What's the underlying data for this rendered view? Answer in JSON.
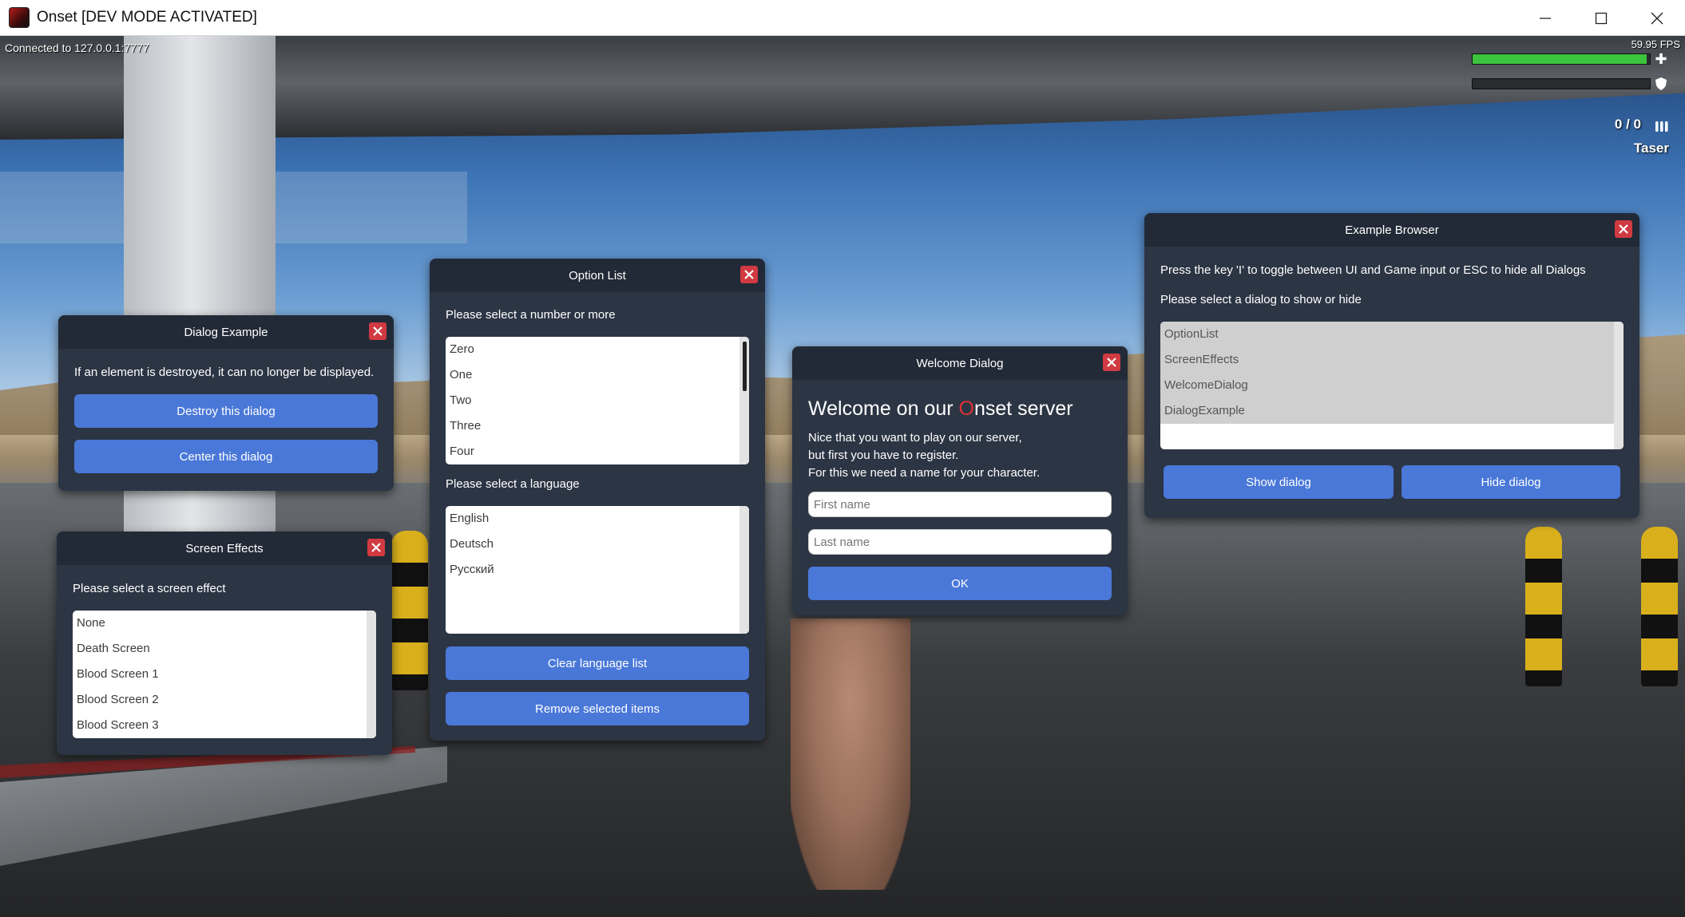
{
  "window": {
    "title": "Onset [DEV MODE ACTIVATED]"
  },
  "hud": {
    "connected": "Connected to 127.0.0.1:7777",
    "fps": "59.95 FPS",
    "health_fraction": 0.98,
    "armor_fraction": 0.0,
    "ammo": "0 / 0",
    "weapon": "Taser",
    "health_icon": "plus-icon",
    "armor_icon": "shield-icon",
    "ammo_icon": "ammo-icon",
    "health_color": "#3cc43c"
  },
  "dialog_example": {
    "title": "Dialog Example",
    "text": "If an element is destroyed, it can no longer be displayed.",
    "destroy_button": "Destroy this dialog",
    "center_button": "Center this dialog"
  },
  "screen_effects": {
    "title": "Screen Effects",
    "label": "Please select a screen effect",
    "items": [
      "None",
      "Death Screen",
      "Blood Screen 1",
      "Blood Screen 2",
      "Blood Screen 3"
    ]
  },
  "option_list": {
    "title": "Option List",
    "number_label": "Please select a number or more",
    "numbers": [
      "Zero",
      "One",
      "Two",
      "Three",
      "Four"
    ],
    "language_label": "Please select a language",
    "languages": [
      "English",
      "Deutsch",
      "Русский"
    ],
    "clear_button": "Clear language list",
    "remove_button": "Remove selected items"
  },
  "welcome_dialog": {
    "title": "Welcome Dialog",
    "heading_pre": "Welcome on our ",
    "heading_red": "O",
    "heading_post": "nset server",
    "line1": "Nice that you want to play on our server,",
    "line2": "but first you have to register.",
    "line3": "For this we need a name for your character.",
    "first_name_placeholder": "First name",
    "last_name_placeholder": "Last name",
    "ok_button": "OK",
    "accent_color": "#e03232"
  },
  "example_browser": {
    "title": "Example Browser",
    "instruction": "Press the key 'I' to toggle between UI and Game input or ESC to hide all Dialogs",
    "select_label": "Please select a dialog to show or hide",
    "items": [
      "OptionList",
      "ScreenEffects",
      "WelcomeDialog",
      "DialogExample"
    ],
    "show_button": "Show dialog",
    "hide_button": "Hide dialog"
  },
  "theme": {
    "dialog_bg": "#2c3544",
    "dialog_header": "#222a37",
    "button": "#4a78d8",
    "close": "#d13a42"
  }
}
